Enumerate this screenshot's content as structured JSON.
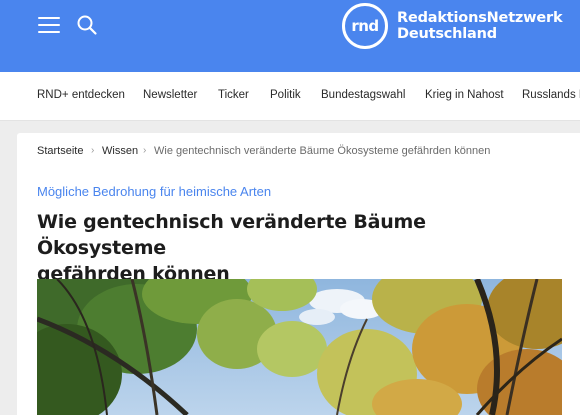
{
  "header": {
    "menu_icon": "hamburger-icon",
    "search_icon": "search-icon",
    "logo": {
      "mark": "rnd",
      "line1": "RedaktionsNetzwerk",
      "line2": "Deutschland"
    },
    "brand_color": "#4a85ee"
  },
  "nav": {
    "items": [
      {
        "label": "RND+ entdecken"
      },
      {
        "label": "Newsletter"
      },
      {
        "label": "Ticker"
      },
      {
        "label": "Politik"
      },
      {
        "label": "Bundestagswahl"
      },
      {
        "label": "Krieg in Nahost"
      },
      {
        "label": "Russlands K"
      }
    ]
  },
  "breadcrumb": {
    "items": [
      {
        "label": "Startseite"
      },
      {
        "label": "Wissen"
      },
      {
        "label": "Wie gentechnisch veränderte Bäume Ökosysteme gefährden können"
      }
    ],
    "separator": "›"
  },
  "article": {
    "kicker": "Mögliche Bedrohung für heimische Arten",
    "title_line1": "Wie gentechnisch veränderte Bäume Ökosysteme",
    "title_line2": "gefährden können",
    "accent_color": "#4a85ee"
  }
}
